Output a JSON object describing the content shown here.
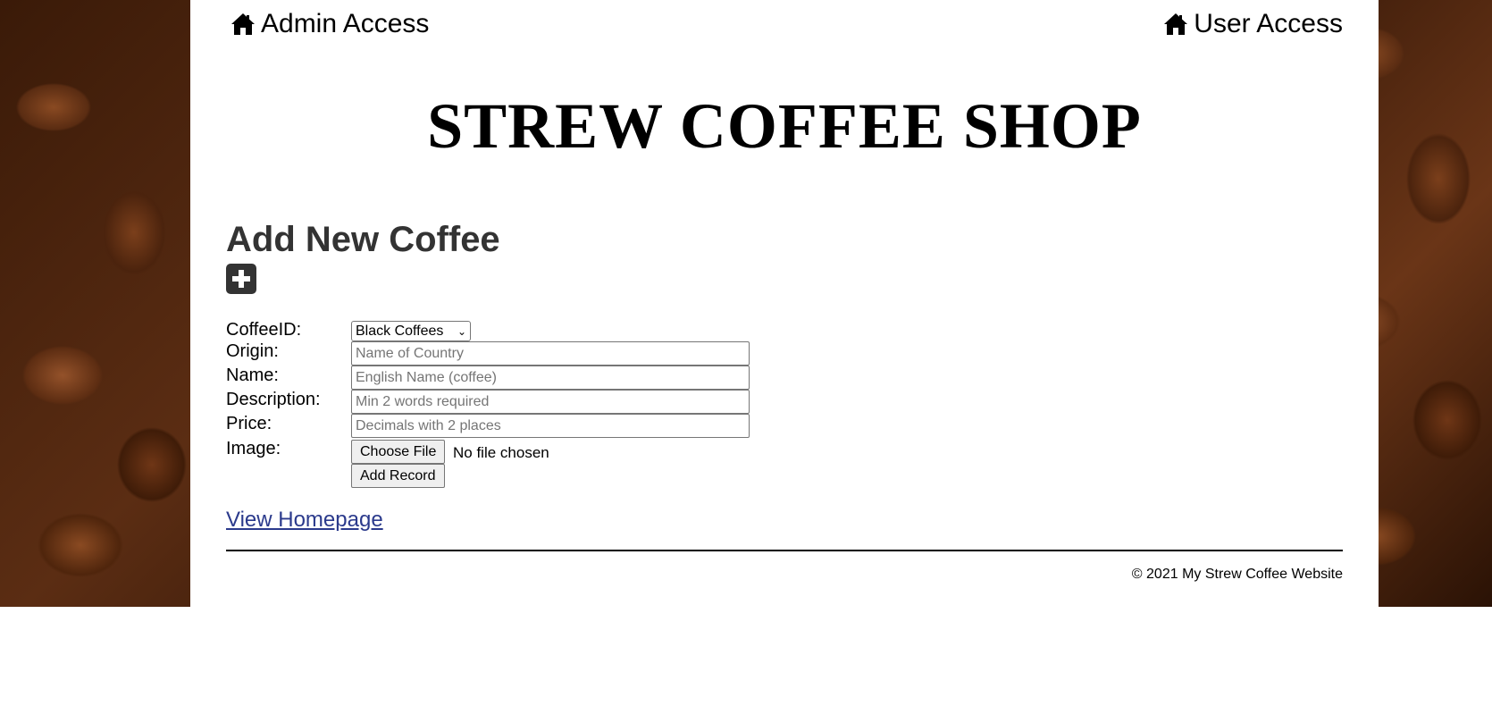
{
  "nav": {
    "admin_label": "Admin Access",
    "user_label": "User Access",
    "icon": "home-icon"
  },
  "site_title": "STREW COFFEE SHOP",
  "form": {
    "title": "Add New Coffee",
    "add_icon": "plus-square-icon",
    "fields": {
      "coffee_id": {
        "label": "CoffeeID:",
        "value": "Black Coffees"
      },
      "origin": {
        "label": "Origin:",
        "placeholder": "Name of Country",
        "value": ""
      },
      "name": {
        "label": "Name:",
        "placeholder": "English Name (coffee)",
        "value": ""
      },
      "description": {
        "label": "Description:",
        "placeholder": "Min 2 words required",
        "value": ""
      },
      "price": {
        "label": "Price:",
        "placeholder": "Decimals with 2 places",
        "value": ""
      },
      "image": {
        "label": "Image:",
        "button_label": "Choose File",
        "status": "No file chosen"
      }
    },
    "submit_label": "Add Record"
  },
  "home_link": "View Homepage",
  "footer": "© 2021 My Strew Coffee Website",
  "colors": {
    "link": "#2b3a8c",
    "heading": "#333333",
    "background_image": "coffee-beans"
  }
}
